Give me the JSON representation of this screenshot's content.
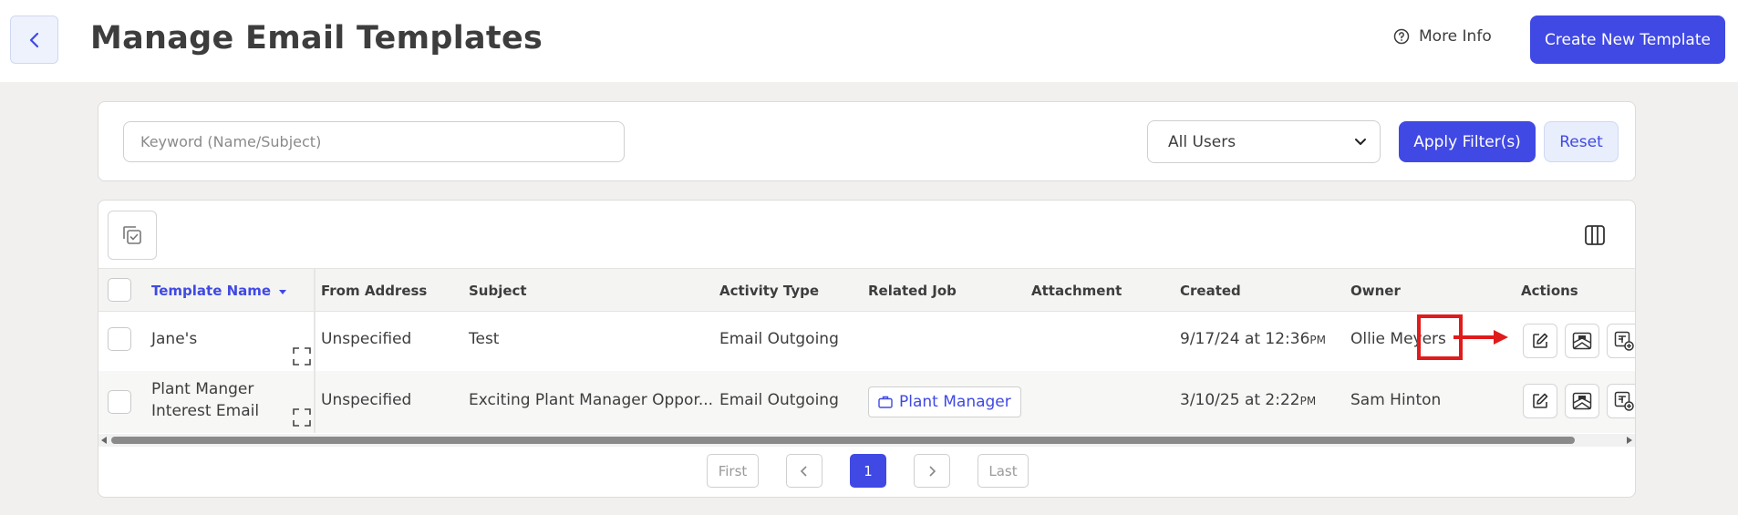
{
  "header": {
    "title": "Manage Email Templates",
    "more_info": "More Info",
    "create_button": "Create New Template"
  },
  "filters": {
    "keyword_placeholder": "Keyword (Name/Subject)",
    "users_selected": "All Users",
    "apply_label": "Apply Filter(s)",
    "reset_label": "Reset"
  },
  "table": {
    "columns": [
      "Template Name",
      "From Address",
      "Subject",
      "Activity Type",
      "Related Job",
      "Attachment",
      "Created",
      "Owner",
      "Actions"
    ],
    "rows": [
      {
        "name": "Jane's",
        "from": "Unspecified",
        "subject": "Test",
        "activity": "Email Outgoing",
        "related_job": "",
        "attachment": "",
        "created": "9/17/24 at 12:36",
        "created_suffix": "PM",
        "owner": "Ollie Meyers"
      },
      {
        "name_line1": "Plant Manger",
        "name_line2": "Interest Email",
        "from": "Unspecified",
        "subject": "Exciting Plant Manager Oppor...",
        "activity": "Email Outgoing",
        "related_job": "Plant Manager",
        "attachment": "",
        "created": "3/10/25 at 2:22",
        "created_suffix": "PM",
        "owner": "Sam Hinton"
      }
    ]
  },
  "pagination": {
    "first": "First",
    "current": "1",
    "last": "Last"
  },
  "colors": {
    "accent": "#4049e3",
    "highlight": "#e01b1b"
  }
}
